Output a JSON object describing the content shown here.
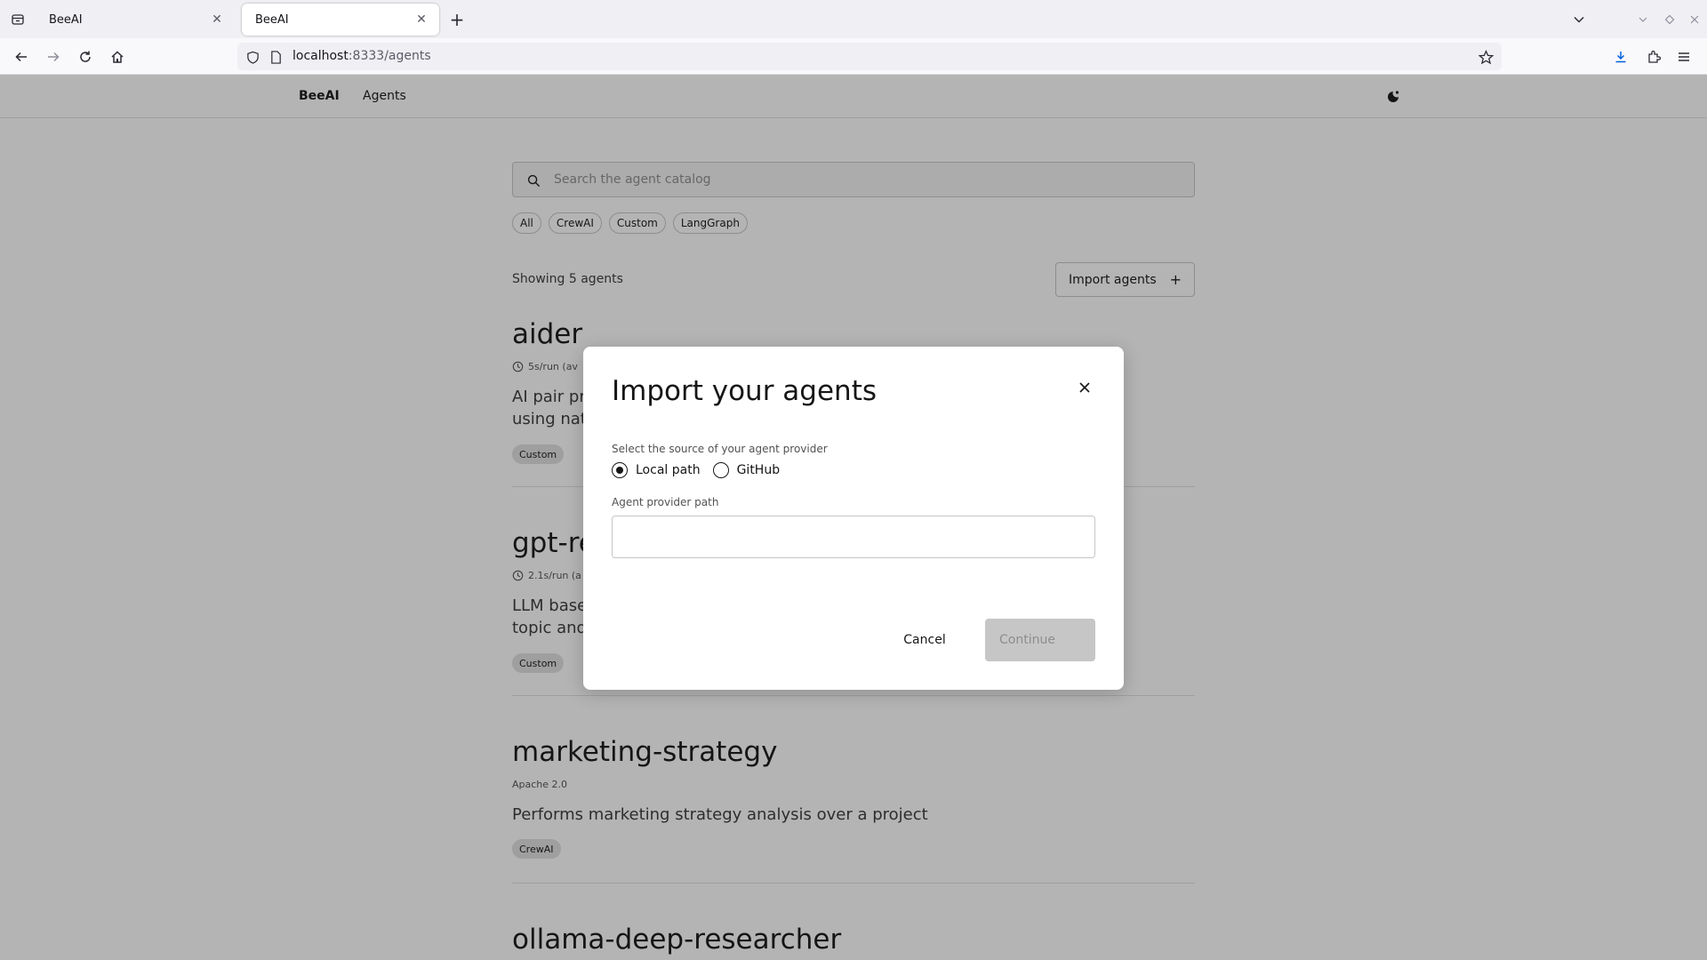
{
  "browser": {
    "tabs": [
      {
        "title": "BeeAI",
        "active": false
      },
      {
        "title": "BeeAI",
        "active": true
      }
    ],
    "url_host": "localhost",
    "url_rest": ":8333/agents"
  },
  "header": {
    "brand": "BeeAI",
    "nav_agents": "Agents"
  },
  "search": {
    "placeholder": "Search the agent catalog"
  },
  "filters": [
    "All",
    "CrewAI",
    "Custom",
    "LangGraph"
  ],
  "catalog": {
    "showing": "Showing 5 agents",
    "import_label": "Import agents"
  },
  "agents": [
    {
      "name": "aider",
      "meta": "5s/run (av",
      "desc_line1": "AI pair pro",
      "desc_line2": "using natu",
      "tag": "Custom"
    },
    {
      "name": "gpt-re",
      "meta": "2.1s/run (a",
      "desc_line1": "LLM based",
      "desc_line2": "topic and",
      "tag": "Custom"
    },
    {
      "name": "marketing-strategy",
      "meta": "Apache 2.0",
      "desc_line1": "Performs marketing strategy analysis over a project",
      "desc_line2": "",
      "tag": "CrewAI"
    },
    {
      "name": "ollama-deep-researcher",
      "meta": "",
      "desc_line1": "",
      "desc_line2": "",
      "tag": ""
    }
  ],
  "modal": {
    "title": "Import your agents",
    "source_label": "Select the source of your agent provider",
    "options": [
      {
        "label": "Local path",
        "selected": true
      },
      {
        "label": "GitHub",
        "selected": false
      }
    ],
    "path_label": "Agent provider path",
    "path_value": "",
    "cancel_label": "Cancel",
    "continue_label": "Continue"
  }
}
